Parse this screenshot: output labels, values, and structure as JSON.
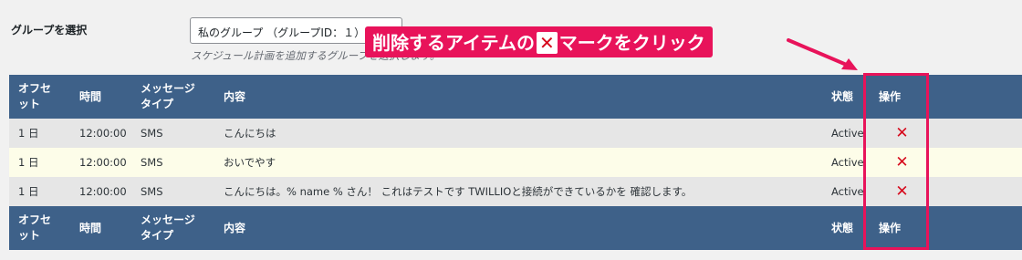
{
  "group": {
    "label": "グループを選択",
    "selected": "私のグループ （グループID：１）",
    "description": "スケジュール計画を追加するグループを選択します。"
  },
  "annotation": {
    "text_before": "削除するアイテムの",
    "x_mark": "✕",
    "text_after": "マークをクリック"
  },
  "table": {
    "headers": {
      "offset": "オフセット",
      "time": "時間",
      "type": "メッセージタイプ",
      "content": "内容",
      "status": "状態",
      "action": "操作"
    },
    "rows": [
      {
        "offset": "1 日",
        "time": "12:00:00",
        "type": "SMS",
        "content": "こんにちは",
        "status": "Active"
      },
      {
        "offset": "1 日",
        "time": "12:00:00",
        "type": "SMS",
        "content": "おいでやす",
        "status": "Active"
      },
      {
        "offset": "1 日",
        "time": "12:00:00",
        "type": "SMS",
        "content": "こんにちは。% name % さん！ これはテストです TWILLIOと接続ができているかを 確認します。",
        "status": "Active"
      }
    ]
  },
  "colors": {
    "header_bg": "#3e6189",
    "annotation": "#e8135a",
    "delete_icon": "#d6091c"
  }
}
